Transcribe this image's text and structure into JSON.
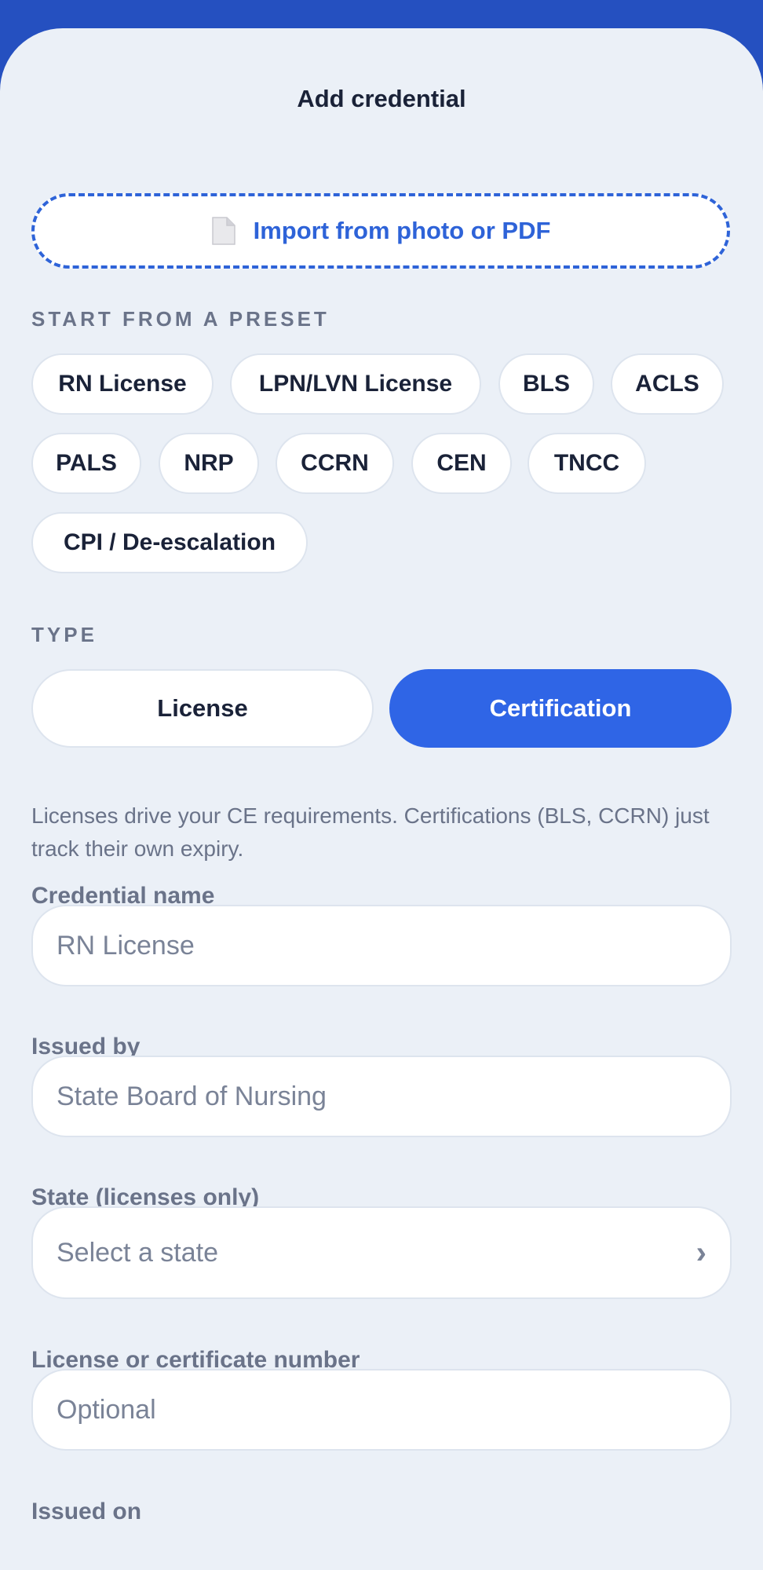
{
  "header": {
    "title": "Add credential"
  },
  "import": {
    "label": "Import from photo or PDF",
    "icon": "document-icon"
  },
  "presets": {
    "section_label": "START FROM A PRESET",
    "items": [
      "RN License",
      "LPN/LVN License",
      "BLS",
      "ACLS",
      "PALS",
      "NRP",
      "CCRN",
      "CEN",
      "TNCC",
      "CPI / De-escalation"
    ]
  },
  "type": {
    "section_label": "TYPE",
    "options": [
      "License",
      "Certification"
    ],
    "selected": "Certification",
    "helper": "Licenses drive your CE requirements. Certifications (BLS, CCRN) just track their own expiry."
  },
  "form": {
    "credential_name": {
      "label": "Credential name",
      "placeholder": "RN License",
      "value": ""
    },
    "issued_by": {
      "label": "Issued by",
      "placeholder": "State Board of Nursing",
      "value": ""
    },
    "state": {
      "label": "State (licenses only)",
      "value": "Select a state",
      "icon": "chevron-right-icon"
    },
    "number": {
      "label": "License or certificate number",
      "placeholder": "Optional",
      "value": ""
    },
    "issued_on": {
      "label": "Issued on"
    }
  },
  "colors": {
    "brand": "#2550c0",
    "accent": "#2f65e6",
    "sheet_bg": "#ebf0f7",
    "text_dark": "#1a2238",
    "text_muted": "#6a7389"
  }
}
